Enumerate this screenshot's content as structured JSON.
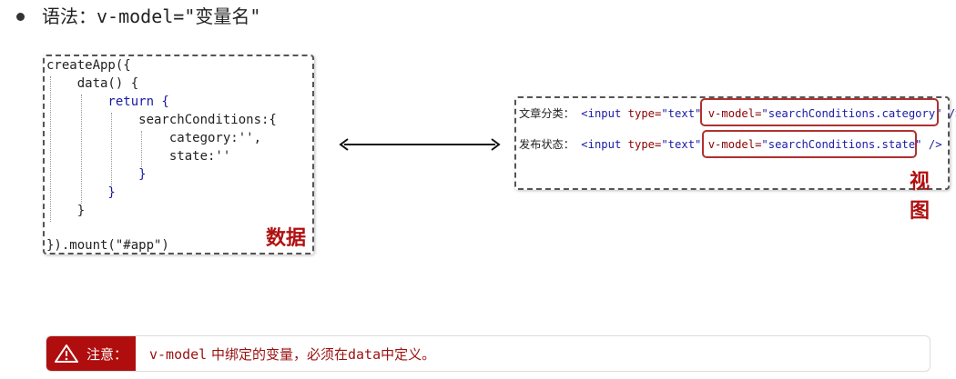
{
  "heading": {
    "label": "语法：",
    "syntax": "v-model=\"变量名\""
  },
  "data_box": {
    "lines": [
      "createApp({",
      "    data() {",
      "        return {",
      "            searchConditions:{",
      "                category:'',",
      "                state:''",
      "            }",
      "        }",
      "    }",
      "",
      "}).mount(\"#app\")"
    ],
    "label": "数据"
  },
  "view_box": {
    "row1": {
      "label": "文章分类：",
      "open": "<input",
      "type_attr": "type=",
      "type_val": "\"text\"",
      "model_attr": "v-model=",
      "model_val": "\"searchConditions.category\"",
      "close": "/>"
    },
    "row2": {
      "label": "发布状态：",
      "open": "<input",
      "type_attr": "type=",
      "type_val": "\"text\"",
      "model_attr": "v-model=",
      "model_val": "\"searchConditions.state\"",
      "close": "/>"
    },
    "label": "视图"
  },
  "notice": {
    "tag": "注意：",
    "code": "v-model",
    "text_before": " 中绑定的变量，必须在",
    "code2": "data",
    "text_after": "中定义。"
  },
  "colors": {
    "accent_red": "#b00e0e",
    "keyword_blue": "#1a1aa6"
  },
  "icons": [
    "warning-icon",
    "double-arrow-icon"
  ]
}
